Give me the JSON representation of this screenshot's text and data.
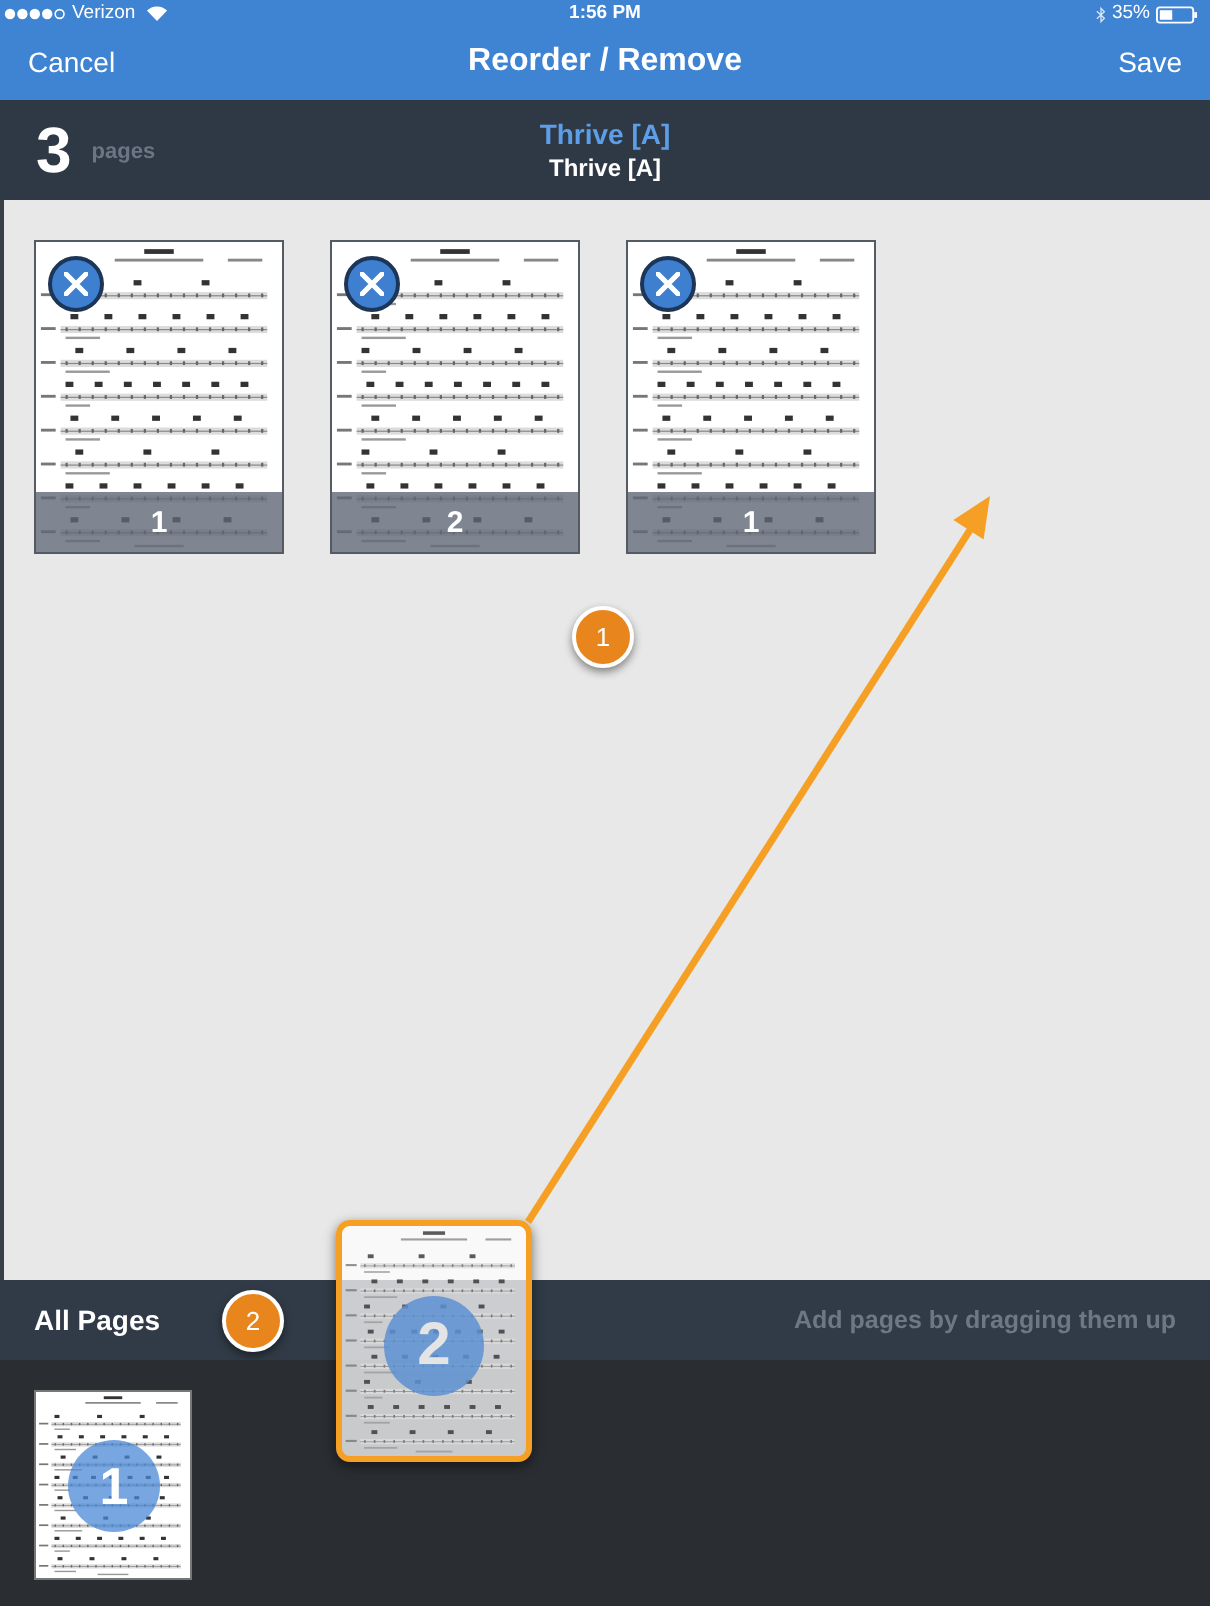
{
  "status_bar": {
    "carrier": "Verizon",
    "time": "1:56 PM",
    "battery": "35%"
  },
  "nav_bar": {
    "cancel": "Cancel",
    "title": "Reorder / Remove",
    "save": "Save"
  },
  "header": {
    "page_count": "3",
    "page_count_label": "pages",
    "song_title": "Thrive [A]",
    "song_subtitle": "Thrive [A]"
  },
  "selected_pages": {
    "pages": [
      {
        "number": "1"
      },
      {
        "number": "2"
      },
      {
        "number": "1"
      }
    ],
    "callout": "1"
  },
  "all_pages": {
    "title": "All Pages",
    "callout": "2",
    "hint": "Add pages by dragging them up",
    "pages": [
      {
        "number": "1"
      }
    ]
  },
  "dragged_page": {
    "number": "2"
  }
}
